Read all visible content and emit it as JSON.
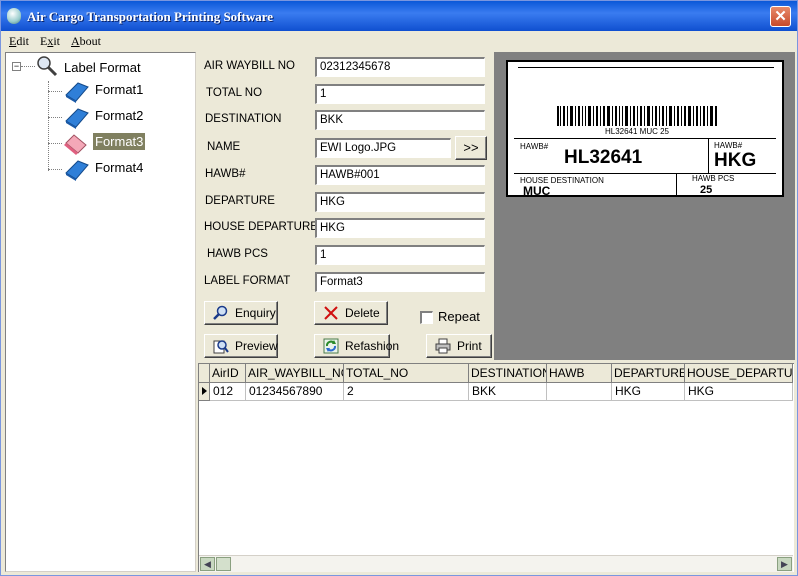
{
  "window": {
    "title": "Air Cargo Transportation  Printing Software"
  },
  "menu": [
    {
      "key": "E",
      "rest": "dit"
    },
    {
      "key": "E",
      "rest": "xit",
      "prefix": ""
    },
    {
      "key": "A",
      "rest": "bout"
    }
  ],
  "menu_labels": {
    "edit_key": "E",
    "edit_rest": "dit",
    "exit_key": "E",
    "exit_rest": "xit",
    "about_key": "A",
    "about_rest": "bout"
  },
  "tree": {
    "root": "Label Format",
    "items": [
      "Format1",
      "Format2",
      "Format3",
      "Format4"
    ],
    "selected": "Format3"
  },
  "form": {
    "air_waybill_no": {
      "label": "AIR WAYBILL NO",
      "value": "02312345678"
    },
    "total_no": {
      "label": "TOTAL NO",
      "value": "1"
    },
    "destination": {
      "label": "DESTINATION",
      "value": "BKK"
    },
    "name": {
      "label": "NAME",
      "value": "EWI Logo.JPG",
      "browse": ">>"
    },
    "hawb": {
      "label": "HAWB#",
      "value": "HAWB#001"
    },
    "departure": {
      "label": "DEPARTURE",
      "value": "HKG"
    },
    "house_departure": {
      "label": "HOUSE DEPARTURE",
      "value": "HKG"
    },
    "hawb_pcs": {
      "label": "HAWB PCS",
      "value": "1"
    },
    "label_format": {
      "label": "LABEL FORMAT",
      "value": "Format3"
    }
  },
  "buttons": {
    "enquiry": "Enquiry",
    "delete": "Delete",
    "repeat": "Repeat",
    "preview": "Preview",
    "refashion": "Refashion",
    "print": "Print"
  },
  "label_preview": {
    "barcode_text": "HL32641 MUC 25",
    "hawb_caption": "HAWB#",
    "hawb_value": "HL32641",
    "hawb2_caption": "HAWB#",
    "hawb2_value": "HKG",
    "house_dest_caption": "HOUSE DESTINATION",
    "house_dest_value": "MUC",
    "pcs_caption": "HAWB PCS",
    "pcs_value": "25"
  },
  "grid": {
    "columns": [
      "AirID",
      "AIR_WAYBILL_NO",
      "TOTAL_NO",
      "DESTINATION",
      "HAWB",
      "DEPARTURE",
      "HOUSE_DEPARTUR"
    ],
    "rows": [
      [
        "012",
        "01234567890",
        "2",
        "BKK",
        "",
        "HKG",
        "HKG"
      ]
    ]
  },
  "colors": {
    "title_bar": "#0a58d8",
    "selection": "#808060",
    "preview_bg": "#808080"
  }
}
